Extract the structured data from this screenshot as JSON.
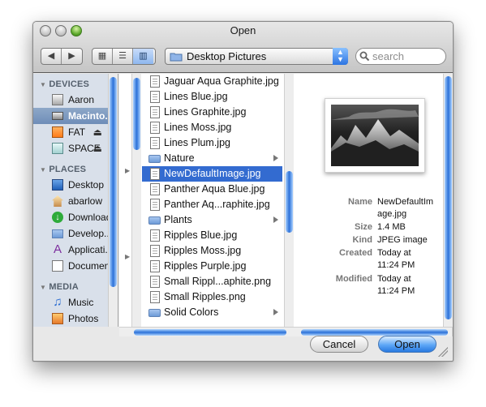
{
  "window": {
    "title": "Open"
  },
  "toolbar": {
    "nav": {
      "back_label": "◀",
      "forward_label": "▶"
    },
    "views": {
      "icon_label": "▦",
      "list_label": "☰",
      "column_label": "▥"
    },
    "path_label": "Desktop Pictures",
    "search_placeholder": "search"
  },
  "sidebar": {
    "sections": [
      {
        "label": "DEVICES",
        "items": [
          "Aaron",
          "Macinto...",
          "FAT",
          "SPACE"
        ]
      },
      {
        "label": "PLACES",
        "items": [
          "Desktop",
          "abarlow",
          "Downloads",
          "Develop...",
          "Applicati...",
          "Documents"
        ]
      },
      {
        "label": "MEDIA",
        "items": [
          "Music",
          "Photos"
        ]
      }
    ]
  },
  "files": [
    {
      "name": "Jaguar Aqua Graphite.jpg",
      "type": "file"
    },
    {
      "name": "Lines Blue.jpg",
      "type": "file"
    },
    {
      "name": "Lines Graphite.jpg",
      "type": "file"
    },
    {
      "name": "Lines Moss.jpg",
      "type": "file"
    },
    {
      "name": "Lines Plum.jpg",
      "type": "file"
    },
    {
      "name": "Nature",
      "type": "folder"
    },
    {
      "name": "NewDefaultImage.jpg",
      "type": "file",
      "selected": true
    },
    {
      "name": "Panther Aqua Blue.jpg",
      "type": "file"
    },
    {
      "name": "Panther Aq...raphite.jpg",
      "type": "file"
    },
    {
      "name": "Plants",
      "type": "folder"
    },
    {
      "name": "Ripples Blue.jpg",
      "type": "file"
    },
    {
      "name": "Ripples Moss.jpg",
      "type": "file"
    },
    {
      "name": "Ripples Purple.jpg",
      "type": "file"
    },
    {
      "name": "Small Rippl...aphite.png",
      "type": "file"
    },
    {
      "name": "Small Ripples.png",
      "type": "file"
    },
    {
      "name": "Solid Colors",
      "type": "folder"
    }
  ],
  "preview": {
    "meta": [
      {
        "label": "Name",
        "value": "NewDefaultIm\nage.jpg"
      },
      {
        "label": "Size",
        "value": "1.4 MB"
      },
      {
        "label": "Kind",
        "value": "JPEG image"
      },
      {
        "label": "Created",
        "value": "Today at\n11:24 PM"
      },
      {
        "label": "Modified",
        "value": "Today at\n11:24 PM"
      }
    ]
  },
  "buttons": {
    "cancel": "Cancel",
    "open": "Open"
  }
}
